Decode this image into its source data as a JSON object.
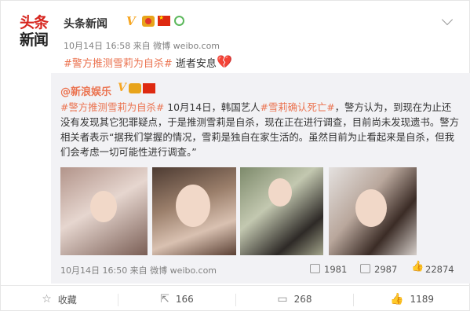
{
  "header": {
    "logo_line1": "头条",
    "logo_line2": "新闻",
    "author": "头条新闻",
    "verified_mark": "V",
    "meta": "10月14日 16:58 来自 微博 weibo.com"
  },
  "post": {
    "tag": "#警方推测雪莉为自杀#",
    "text": " 逝者安息",
    "heart_icon": "💔"
  },
  "repost": {
    "author": "@新浪娱乐",
    "verified_mark": "V",
    "text_parts": [
      {
        "type": "tag",
        "text": "#警方推测雪莉为自杀#"
      },
      {
        "type": "text",
        "text": " 10月14日，韩国艺人"
      },
      {
        "type": "tag",
        "text": "#雪莉确认死亡#"
      },
      {
        "type": "text",
        "text": "，警方认为，到现在为止还没有发现其它犯罪疑点，于是推测雪莉是自杀，现在正在进行调查，目前尚未发现遗书。警方相关者表示“据我们掌握的情况，雪莉是独自在家生活的。虽然目前为止看起来是自杀，但我们会考虑一切可能性进行调查。”"
      }
    ],
    "meta": "10月14日 16:50 来自 微博 weibo.com",
    "share_count": "1981",
    "comment_count": "2987",
    "like_count": "22874"
  },
  "actions": {
    "favorite": "收藏",
    "share": "166",
    "comment": "268",
    "like": "1189"
  },
  "colors": {
    "accent": "#eb7350",
    "text": "#333333",
    "muted": "#808080",
    "repost_bg": "#f2f2f5"
  }
}
